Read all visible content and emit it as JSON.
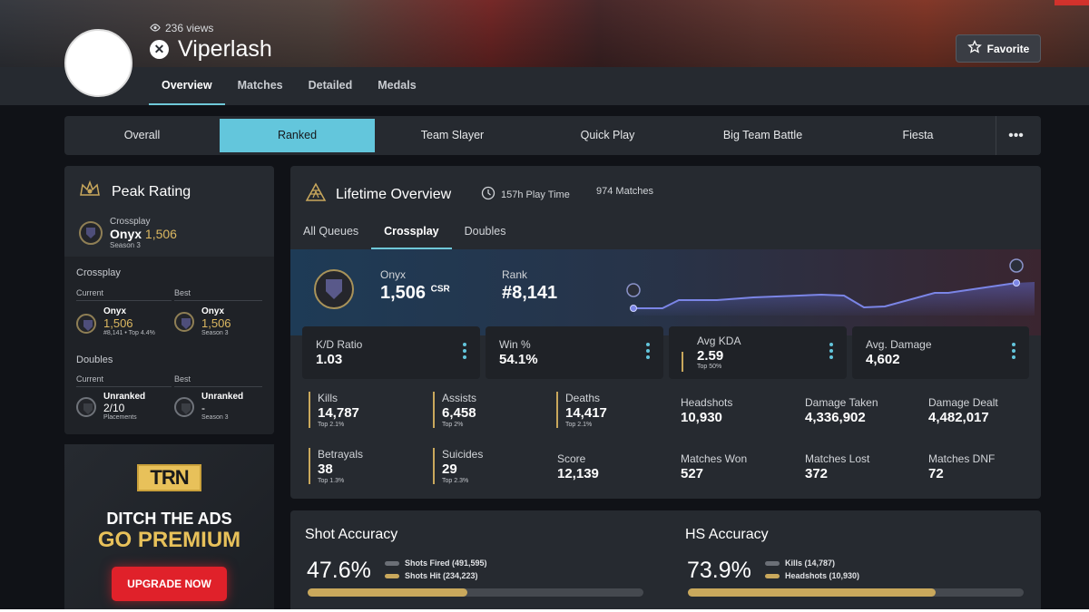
{
  "profile": {
    "views": "236 views",
    "username": "Viperlash",
    "favorite_label": "Favorite"
  },
  "top_tabs": [
    "Overview",
    "Matches",
    "Detailed",
    "Medals"
  ],
  "modes": [
    "Overall",
    "Ranked",
    "Team Slayer",
    "Quick Play",
    "Big Team Battle",
    "Fiesta"
  ],
  "modes_more": "•••",
  "peak": {
    "title": "Peak Rating",
    "playlist": "Crossplay",
    "rank": "Onyx",
    "rating": "1,506",
    "season": "Season 3",
    "crossplay": {
      "section": "Crossplay",
      "current_label": "Current",
      "best_label": "Best",
      "current_rank": "Onyx",
      "current_rating": "1,506",
      "current_sub": "#8,141 • Top 4.4%",
      "best_rank": "Onyx",
      "best_rating": "1,506",
      "best_sub": "Season 3"
    },
    "doubles": {
      "section": "Doubles",
      "current_label": "Current",
      "best_label": "Best",
      "current_rank": "Unranked",
      "current_rating": "2/10",
      "current_sub": "Placements",
      "best_rank": "Unranked",
      "best_rating": "-",
      "best_sub": "Season 3"
    }
  },
  "ad": {
    "logo": "TRN",
    "line1": "DITCH THE ADS",
    "line2": "GO PREMIUM",
    "button": "UPGRADE NOW"
  },
  "lifetime": {
    "title": "Lifetime Overview",
    "playtime": "157h Play Time",
    "matches": "974 Matches",
    "tabs": [
      "All Queues",
      "Crossplay",
      "Doubles"
    ],
    "rank_name": "Onyx",
    "csr": "1,506",
    "csr_unit": "CSR",
    "rank_label": "Rank",
    "rank_value": "#8,141",
    "cards": [
      {
        "label": "K/D Ratio",
        "value": "1.03",
        "sub": ""
      },
      {
        "label": "Win %",
        "value": "54.1%",
        "sub": ""
      },
      {
        "label": "Avg KDA",
        "value": "2.59",
        "sub": "Top 50%"
      },
      {
        "label": "Avg. Damage",
        "value": "4,602",
        "sub": ""
      }
    ],
    "stats": [
      {
        "label": "Kills",
        "value": "14,787",
        "sub": "Top 2.1%"
      },
      {
        "label": "Assists",
        "value": "6,458",
        "sub": "Top 2%"
      },
      {
        "label": "Deaths",
        "value": "14,417",
        "sub": "Top 2.1%"
      },
      {
        "label": "Headshots",
        "value": "10,930",
        "sub": ""
      },
      {
        "label": "Damage Taken",
        "value": "4,336,902",
        "sub": ""
      },
      {
        "label": "Damage Dealt",
        "value": "4,482,017",
        "sub": ""
      },
      {
        "label": "Betrayals",
        "value": "38",
        "sub": "Top 1.3%"
      },
      {
        "label": "Suicides",
        "value": "29",
        "sub": "Top 2.3%"
      },
      {
        "label": "Score",
        "value": "12,139",
        "sub": ""
      },
      {
        "label": "Matches Won",
        "value": "527",
        "sub": ""
      },
      {
        "label": "Matches Lost",
        "value": "372",
        "sub": ""
      },
      {
        "label": "Matches DNF",
        "value": "72",
        "sub": ""
      }
    ]
  },
  "accuracy": {
    "shot": {
      "title": "Shot Accuracy",
      "value": "47.6%",
      "fraction": 0.476,
      "legend1": "Shots Fired (491,595)",
      "legend2": "Shots Hit (234,223)"
    },
    "hs": {
      "title": "HS Accuracy",
      "value": "73.9%",
      "fraction": 0.739,
      "legend1": "Kills (14,787)",
      "legend2": "Headshots (10,930)"
    }
  },
  "colors": {
    "accent": "#63c6dc",
    "gold": "#c9a85c",
    "panel": "#262a30"
  },
  "icons": [
    "eye-icon",
    "xbox-icon",
    "star-icon",
    "peak-rating-icon",
    "onyx-rank-icon",
    "unranked-icon",
    "lifetime-icon",
    "clock-icon",
    "more-vert-icon"
  ]
}
